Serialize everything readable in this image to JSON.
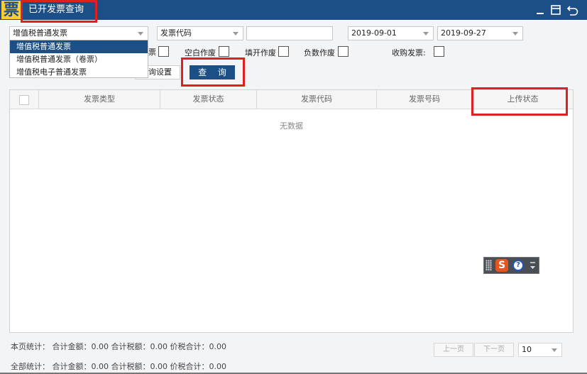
{
  "titlebar": {
    "logo_char": "票",
    "title": "已开发票查询"
  },
  "filters": {
    "invoice_type": {
      "selected": "增值税普通发票"
    },
    "field_select": {
      "selected": "发票代码"
    },
    "search_text": {
      "value": ""
    },
    "date_from": "2019-09-01",
    "date_to": "2019-09-27"
  },
  "dropdown": {
    "items": [
      "增值税普通发票",
      "增值税普通发票（卷票）",
      "增值税电子普通发票"
    ]
  },
  "checkboxes": {
    "partial_label": "票",
    "blank_void": "空白作废",
    "filled_void": "填开作废",
    "negative_void": "负数作废",
    "purchase_invoice": "收购发票:"
  },
  "buttons": {
    "query_settings_partial": "询设置",
    "query": "查 询"
  },
  "table": {
    "headers": [
      "发票类型",
      "发票状态",
      "发票代码",
      "发票号码",
      "上传状态"
    ],
    "empty_text": "无数据"
  },
  "footer": {
    "page_stats": "本页统计： 合计金额：0.00  合计税额：0.00   价税合计：0.00",
    "all_stats": "全部统计： 合计金额：0.00  合计税额：0.00   价税合计：0.00",
    "prev_page": "上一页",
    "next_page": "下一页",
    "page_size": "10"
  },
  "ime": {
    "logo_char": "S",
    "help_char": "?"
  },
  "colors": {
    "titlebar": "#1b4f85",
    "highlight": "#e02020",
    "logo_bg": "#ffcc33",
    "ime_logo": "#e8541e"
  }
}
